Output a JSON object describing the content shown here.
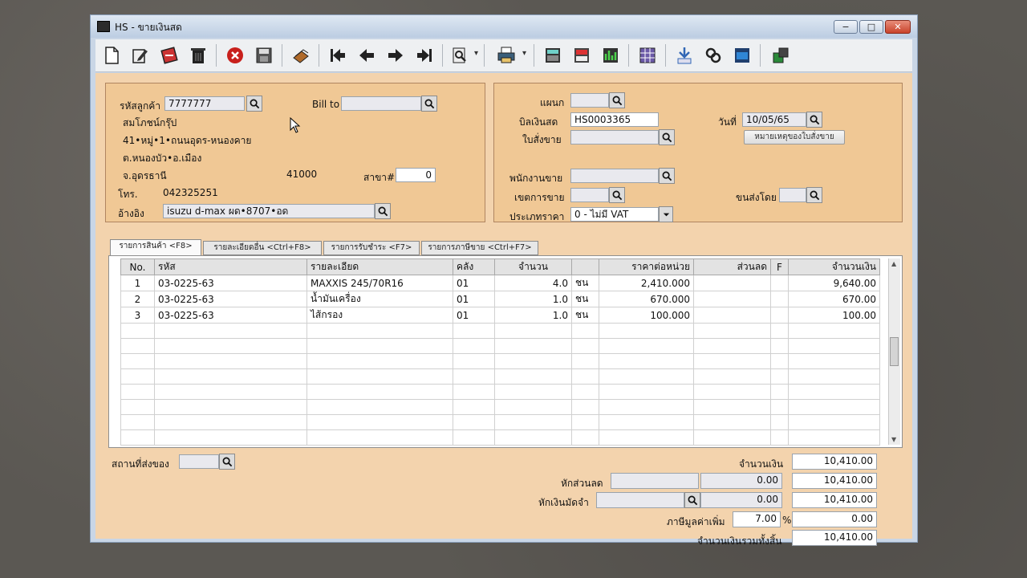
{
  "window": {
    "title": "HS - ขายเงินสด",
    "minimize": "−",
    "maximize": "□",
    "close": "✕"
  },
  "toolbar": {
    "icons": [
      "new-icon",
      "edit-icon",
      "copy-icon",
      "delete-icon",
      "cancel-icon",
      "save-icon",
      "attach-icon",
      "first-icon",
      "prev-icon",
      "next-icon",
      "last-icon",
      "find-icon",
      "print-icon",
      "calculator-icon",
      "report-icon",
      "chart-icon",
      "grid-icon",
      "link-icon",
      "chain-icon",
      "ok-icon",
      "export-icon"
    ],
    "dropdown": "▾"
  },
  "customer": {
    "code_label": "รหัสลูกค้า",
    "code": "7777777",
    "billto_label": "Bill to",
    "billto": "",
    "name": "สมโภชน์กรุ๊ป",
    "addr1": "41•หมู่•1•ถนนอุดร-หนองคาย",
    "addr2": "ต.หนองบัว•อ.เมือง",
    "province": "จ.อุดรธานี",
    "zip": "41000",
    "branch_label": "สาขา#",
    "branch": "0",
    "phone_label": "โทร.",
    "phone": "042325251",
    "ref_label": "อ้างอิง",
    "ref": "isuzu d-max ผด•8707•อด"
  },
  "doc": {
    "dept_label": "แผนก",
    "dept": "",
    "bill_label": "บิลเงินสด",
    "bill": "HS0003365",
    "date_label": "วันที่",
    "date": "10/05/65",
    "so_label": "ใบสั่งขาย",
    "so": "",
    "so_note_btn": "หมายเหตุของใบสั่งขาย",
    "sales_label": "พนักงานขาย",
    "sales": "",
    "area_label": "เขตการขาย",
    "area": "",
    "ship_label": "ขนส่งโดย",
    "ship": "",
    "price_label": "ประเภทราคา",
    "price": "0 - ไม่มี VAT"
  },
  "tabs": [
    "รายการสินค้า <F8>",
    "รายละเอียดอื่น <Ctrl+F8>",
    "รายการรับชำระ <F7>",
    "รายการภาษีขาย <Ctrl+F7>"
  ],
  "grid": {
    "headers": [
      "No.",
      "รหัส",
      "รายละเอียด",
      "คลัง",
      "จำนวน",
      "",
      "ราคาต่อหน่วย",
      "ส่วนลด",
      "F",
      "จำนวนเงิน"
    ],
    "rows": [
      [
        "1",
        "03-0225-63",
        "MAXXIS 245/70R16",
        "01",
        "4.0",
        "ชน",
        "2,410.000",
        "",
        "",
        "9,640.00"
      ],
      [
        "2",
        "03-0225-63",
        "น้ำมันเครื่อง",
        "01",
        "1.0",
        "ชน",
        "670.000",
        "",
        "",
        "670.00"
      ],
      [
        "3",
        "03-0225-63",
        "ไส้กรอง",
        "01",
        "1.0",
        "ชน",
        "100.000",
        "",
        "",
        "100.00"
      ]
    ],
    "empty_rows": 8
  },
  "footer": {
    "shipto_label": "สถานที่ส่งของ",
    "shipto": "",
    "amount_label": "จำนวนเงิน",
    "amount": "10,410.00",
    "discount_label": "หักส่วนลด",
    "discount_code": "",
    "discount": "0.00",
    "after_discount": "10,410.00",
    "deposit_label": "หักเงินมัดจำ",
    "deposit_code": "",
    "deposit": "0.00",
    "after_deposit": "10,410.00",
    "vat_label": "ภาษีมูลค่าเพิ่ม",
    "vat_rate": "7.00",
    "vat_pct": "%",
    "vat": "0.00",
    "total_label": "จำนวนเงินรวมทั้งสิ้น",
    "total": "10,410.00"
  }
}
